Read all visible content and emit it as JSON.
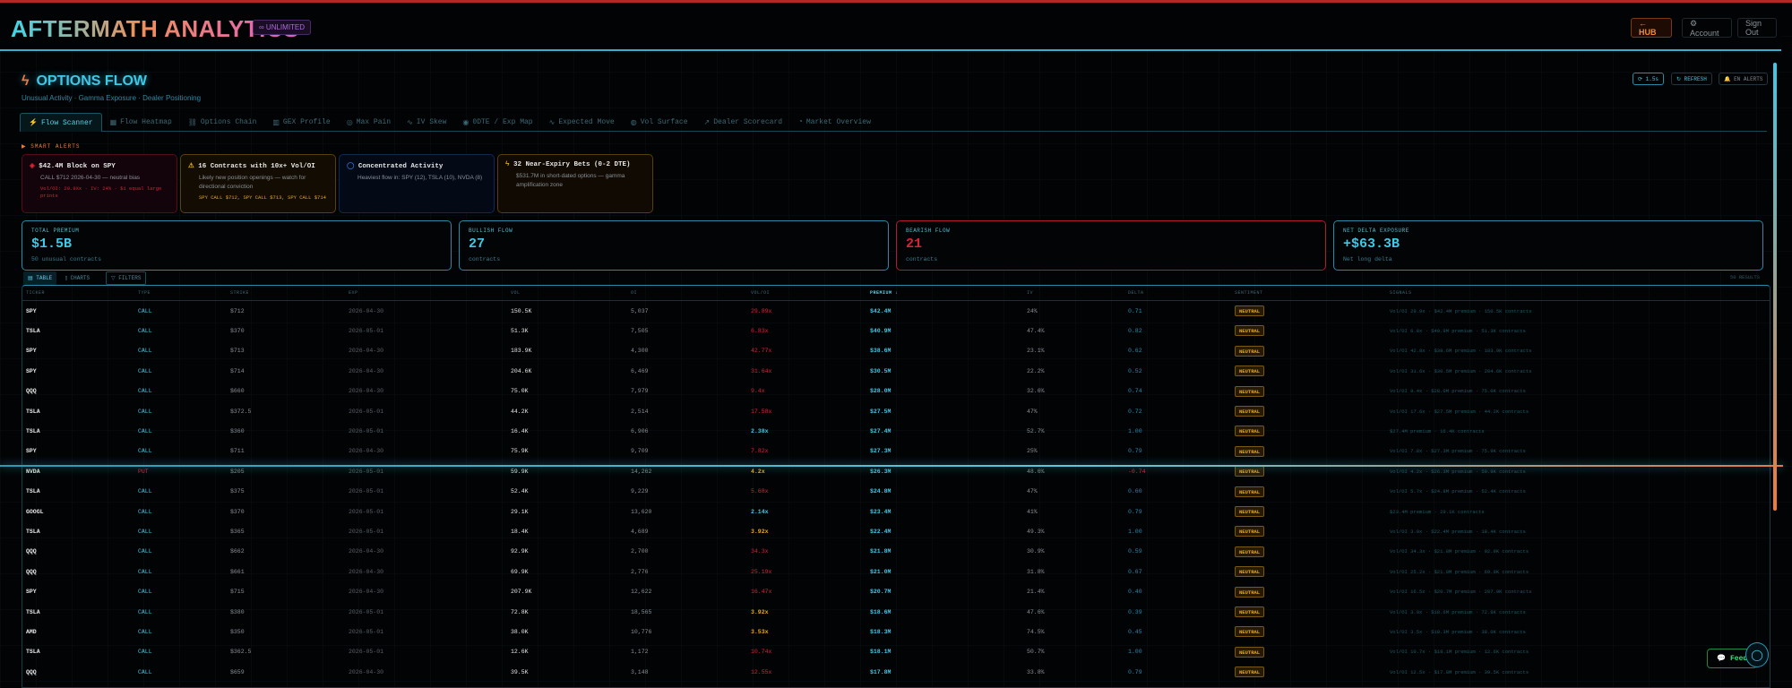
{
  "header": {
    "logo": "AFTERMATH ANALYTICS",
    "plan_badge": "∞ UNLIMITED",
    "hub": "← HUB",
    "account": "⚙ Account",
    "sign_out": "Sign Out"
  },
  "page": {
    "title": "OPTIONS FLOW",
    "subtitle": "Unusual Activity · Gamma Exposure · Dealer Positioning",
    "buttons": {
      "refresh_rate": "⟳ 1.5s",
      "refresh": "↻ REFRESH",
      "alerts": "🔔 EN ALERTS"
    }
  },
  "tabs": [
    {
      "icon": "⚡",
      "label": "Flow Scanner"
    },
    {
      "icon": "▦",
      "label": "Flow Heatmap"
    },
    {
      "icon": "⛓",
      "label": "Options Chain"
    },
    {
      "icon": "▥",
      "label": "GEX Profile"
    },
    {
      "icon": "◎",
      "label": "Max Pain"
    },
    {
      "icon": "∿",
      "label": "IV Skew"
    },
    {
      "icon": "◉",
      "label": "0DTE / Exp Map"
    },
    {
      "icon": "∿",
      "label": "Expected Move"
    },
    {
      "icon": "◍",
      "label": "Vol Surface"
    },
    {
      "icon": "↗",
      "label": "Dealer Scorecard"
    },
    {
      "icon": "◔",
      "label": "Market Overview"
    }
  ],
  "alerts": {
    "label": "▶ SMART ALERTS",
    "items": [
      {
        "icon": "◈",
        "title": "$42.4M Block on SPY",
        "body": "CALL $712 2026-04-30 — neutral bias",
        "detail": "Vol/OI: 29.9Xx · IV: 24% · $1 equal large prints",
        "color": "#d8223a"
      },
      {
        "icon": "⚠",
        "title": "16 Contracts with 10x+ Vol/OI",
        "body": "Likely new position openings — watch for directional conviction",
        "detail": "SPY CALL $712, SPY CALL $713, SPY CALL $714",
        "color": "#e8a820"
      },
      {
        "icon": "◯",
        "title": "Concentrated Activity",
        "body": "Heaviest flow in: SPY (12), TSLA (10), NVDA (8)",
        "detail": "",
        "color": "#2a6ac8"
      },
      {
        "icon": "ϟ",
        "title": "32 Near-Expiry Bets (0-2 DTE)",
        "body": "$531.7M in short-dated options — gamma amplification zone",
        "detail": "",
        "color": "#e8a820"
      }
    ]
  },
  "stats": [
    {
      "label": "TOTAL PREMIUM",
      "value": "$1.5B",
      "sub": "50 unusual contracts"
    },
    {
      "label": "BULLISH FLOW",
      "value": "27",
      "sub": "contracts"
    },
    {
      "label": "BEARISH FLOW",
      "value": "21",
      "sub": "contracts"
    },
    {
      "label": "NET DELTA EXPOSURE",
      "value": "+$63.3B",
      "sub": "Net long delta"
    }
  ],
  "view": {
    "table": "▤ TABLE",
    "charts": "⫾ CHARTS",
    "filters": "▽ FILTERS",
    "results": "50 RESULTS"
  },
  "table": {
    "headers": [
      "TICKER",
      "TYPE",
      "STRIKE",
      "EXP",
      "VOL",
      "OI",
      "VOL/OI",
      "PREMIUM ↓",
      "IV",
      "DELTA",
      "SENTIMENT",
      "SIGNALS"
    ],
    "rows": [
      [
        "SPY",
        "CALL",
        "$712",
        "2026-04-30",
        "150.5K",
        "5,037",
        "29.89x",
        "$42.4M",
        "24%",
        "0.71",
        "NEUTRAL",
        "Vol/OI 29.9x · $42.4M premium · 150.5K contracts"
      ],
      [
        "TSLA",
        "CALL",
        "$370",
        "2026-05-01",
        "51.3K",
        "7,505",
        "6.83x",
        "$40.9M",
        "47.4%",
        "0.82",
        "NEUTRAL",
        "Vol/OI 6.8x · $40.9M premium · 51.3K contracts"
      ],
      [
        "SPY",
        "CALL",
        "$713",
        "2026-04-30",
        "183.9K",
        "4,300",
        "42.77x",
        "$38.6M",
        "23.1%",
        "0.62",
        "NEUTRAL",
        "Vol/OI 42.8x · $38.6M premium · 183.9K contracts"
      ],
      [
        "SPY",
        "CALL",
        "$714",
        "2026-04-30",
        "204.6K",
        "6,469",
        "31.64x",
        "$30.5M",
        "22.2%",
        "0.52",
        "NEUTRAL",
        "Vol/OI 31.6x · $30.5M premium · 204.6K contracts"
      ],
      [
        "QQQ",
        "CALL",
        "$660",
        "2026-04-30",
        "75.0K",
        "7,979",
        "9.4x",
        "$28.0M",
        "32.6%",
        "0.74",
        "NEUTRAL",
        "Vol/OI 9.4x · $28.0M premium · 75.0K contracts"
      ],
      [
        "TSLA",
        "CALL",
        "$372.5",
        "2026-05-01",
        "44.2K",
        "2,514",
        "17.58x",
        "$27.5M",
        "47%",
        "0.72",
        "NEUTRAL",
        "Vol/OI 17.6x · $27.5M premium · 44.2K contracts"
      ],
      [
        "TSLA",
        "CALL",
        "$360",
        "2026-05-01",
        "16.4K",
        "6,906",
        "2.38x",
        "$27.4M",
        "52.7%",
        "1.00",
        "NEUTRAL",
        "$27.4M premium · 16.4K contracts"
      ],
      [
        "SPY",
        "CALL",
        "$711",
        "2026-04-30",
        "75.9K",
        "9,709",
        "7.82x",
        "$27.3M",
        "25%",
        "0.79",
        "NEUTRAL",
        "Vol/OI 7.8x · $27.3M premium · 75.9K contracts"
      ],
      [
        "NVDA",
        "PUT",
        "$205",
        "2026-05-01",
        "59.9K",
        "14,262",
        "4.2x",
        "$26.3M",
        "48.6%",
        "-0.74",
        "NEUTRAL",
        "Vol/OI 4.2x · $26.3M premium · 59.9K contracts"
      ],
      [
        "TSLA",
        "CALL",
        "$375",
        "2026-05-01",
        "52.4K",
        "9,229",
        "5.68x",
        "$24.8M",
        "47%",
        "0.60",
        "NEUTRAL",
        "Vol/OI 5.7x · $24.8M premium · 52.4K contracts"
      ],
      [
        "GOOGL",
        "CALL",
        "$370",
        "2026-05-01",
        "29.1K",
        "13,620",
        "2.14x",
        "$23.4M",
        "41%",
        "0.79",
        "NEUTRAL",
        "$23.4M premium · 29.1K contracts"
      ],
      [
        "TSLA",
        "CALL",
        "$365",
        "2026-05-01",
        "18.4K",
        "4,689",
        "3.92x",
        "$22.4M",
        "49.3%",
        "1.00",
        "NEUTRAL",
        "Vol/OI 3.9x · $22.4M premium · 18.4K contracts"
      ],
      [
        "QQQ",
        "CALL",
        "$662",
        "2026-04-30",
        "92.9K",
        "2,700",
        "34.3x",
        "$21.8M",
        "30.9%",
        "0.59",
        "NEUTRAL",
        "Vol/OI 34.3x · $21.8M premium · 92.9K contracts"
      ],
      [
        "QQQ",
        "CALL",
        "$661",
        "2026-04-30",
        "69.9K",
        "2,776",
        "25.19x",
        "$21.0M",
        "31.8%",
        "0.67",
        "NEUTRAL",
        "Vol/OI 25.2x · $21.0M premium · 69.9K contracts"
      ],
      [
        "SPY",
        "CALL",
        "$715",
        "2026-04-30",
        "207.9K",
        "12,622",
        "16.47x",
        "$20.7M",
        "21.4%",
        "0.40",
        "NEUTRAL",
        "Vol/OI 16.5x · $20.7M premium · 207.9K contracts"
      ],
      [
        "TSLA",
        "CALL",
        "$380",
        "2026-05-01",
        "72.8K",
        "18,565",
        "3.92x",
        "$18.6M",
        "47.6%",
        "0.39",
        "NEUTRAL",
        "Vol/OI 3.9x · $18.6M premium · 72.8K contracts"
      ],
      [
        "AMD",
        "CALL",
        "$350",
        "2026-05-01",
        "38.0K",
        "10,776",
        "3.53x",
        "$18.3M",
        "74.5%",
        "0.45",
        "NEUTRAL",
        "Vol/OI 3.5x · $18.3M premium · 38.0K contracts"
      ],
      [
        "TSLA",
        "CALL",
        "$362.5",
        "2026-05-01",
        "12.6K",
        "1,172",
        "10.74x",
        "$18.1M",
        "50.7%",
        "1.00",
        "NEUTRAL",
        "Vol/OI 10.7x · $18.1M premium · 12.6K contracts"
      ],
      [
        "QQQ",
        "CALL",
        "$659",
        "2026-04-30",
        "39.5K",
        "3,148",
        "12.55x",
        "$17.8M",
        "33.8%",
        "0.79",
        "NEUTRAL",
        "Vol/OI 12.5x · $17.8M premium · 39.5K contracts"
      ]
    ]
  },
  "feedback": {
    "label": "Feed"
  },
  "colors": {
    "accent": "#3fc8e6",
    "bear": "#d8223a",
    "warn": "#e8a820",
    "hub": "#f08a3a"
  }
}
